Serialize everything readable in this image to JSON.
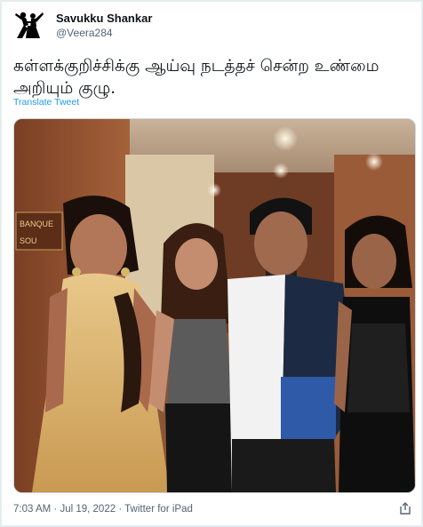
{
  "tweet": {
    "author_name": "Savukku Shankar",
    "handle": "@Veera284",
    "text": "கள்ளக்குறிச்சிக்கு ஆய்வு நடத்தச் சென்ற உண்மை அறியும் குழு.",
    "translate_label": "Translate Tweet",
    "time": "7:03 AM",
    "date": "Jul 19, 2022",
    "client": "Twitter for iPad",
    "separator": "·"
  },
  "photo": {
    "wall_sign_top": "BANQUE",
    "wall_sign_bottom": "SOU"
  },
  "icons": {
    "avatar": "dancing-silhouette-icon",
    "share": "share-icon"
  },
  "colors": {
    "link": "#1d9bf0",
    "secondary_text": "#536471",
    "border": "#e6ecf0"
  }
}
